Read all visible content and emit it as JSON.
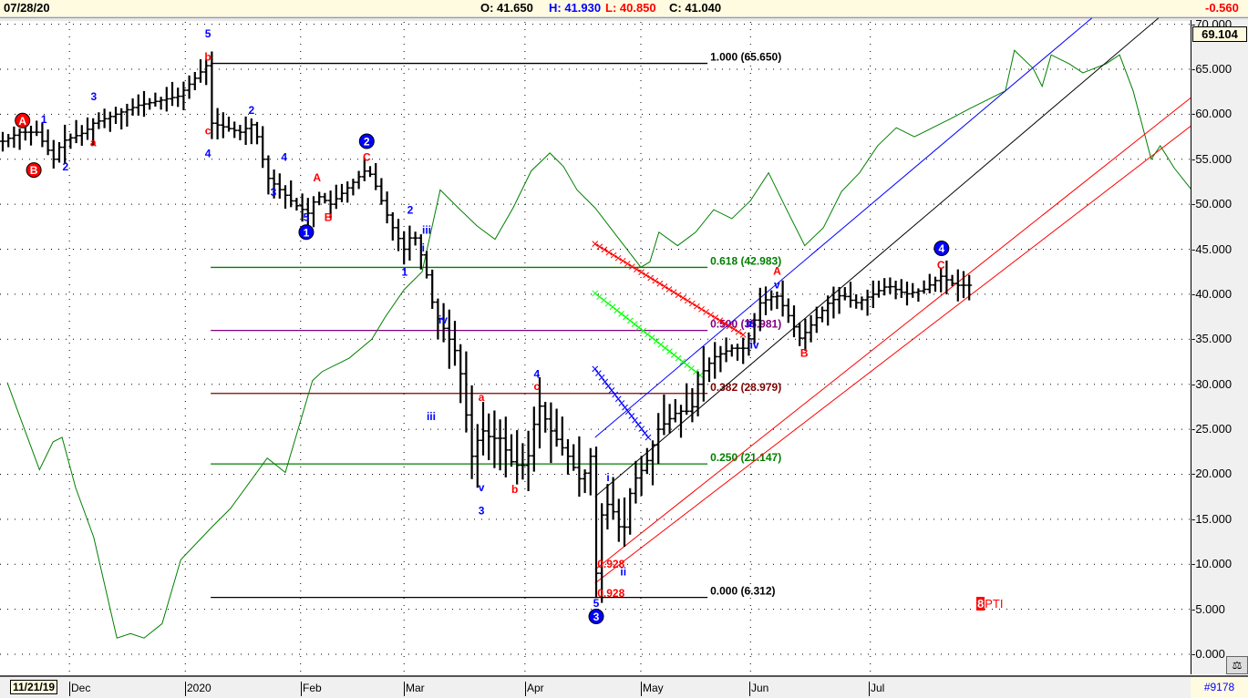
{
  "header": {
    "date": "07/28/20",
    "open": "O: 41.650",
    "high": "H: 41.930",
    "low": "L: 40.850",
    "close": "C: 41.040",
    "change": "-0.560"
  },
  "axis": {
    "last_value": "69.104",
    "count": "#9178",
    "start_date": "11/21/19",
    "months": [
      "Dec",
      "2020",
      "Feb",
      "Mar",
      "Apr",
      "May",
      "Jun",
      "Jul"
    ]
  },
  "indicator_label": {
    "number": "8",
    "name": "PTI"
  },
  "colors": {
    "bars": "#000000",
    "oscillator": "#008000",
    "up": "#0000ff",
    "down": "#ff0000"
  },
  "chart_data": {
    "type": "ohlc",
    "ylim": [
      -2,
      72
    ],
    "y_ticks": [
      "0.000",
      "5.000",
      "10.000",
      "15.000",
      "20.000",
      "25.000",
      "30.000",
      "35.000",
      "40.000",
      "45.000",
      "50.000",
      "55.000",
      "60.000",
      "65.000",
      "70.000"
    ],
    "y_tick_values": [
      0,
      5,
      10,
      15,
      20,
      25,
      30,
      35,
      40,
      45,
      50,
      55,
      60,
      65,
      70
    ],
    "month_days": [
      11.8,
      32.3,
      52.7,
      71,
      92.4,
      112.9,
      132.3,
      153.5
    ],
    "price_path": [
      [
        0,
        57
      ],
      [
        3,
        58
      ],
      [
        6,
        58
      ],
      [
        9,
        55
      ],
      [
        10.5,
        57
      ],
      [
        14.5,
        58
      ],
      [
        16,
        59
      ],
      [
        24,
        61
      ],
      [
        31,
        62
      ],
      [
        34,
        64
      ],
      [
        36.3,
        65.6
      ],
      [
        37,
        59
      ],
      [
        42,
        58
      ],
      [
        44.4,
        59
      ],
      [
        46.8,
        53
      ],
      [
        48.4,
        52
      ],
      [
        51.6,
        50
      ],
      [
        54,
        49
      ],
      [
        55.6,
        51
      ],
      [
        58,
        50
      ],
      [
        61.3,
        52
      ],
      [
        64.5,
        54
      ],
      [
        66,
        52
      ],
      [
        68.5,
        48
      ],
      [
        71,
        45
      ],
      [
        72.6,
        47
      ],
      [
        74.2,
        44
      ],
      [
        75.5,
        41
      ],
      [
        76.3,
        38
      ],
      [
        78.2,
        36
      ],
      [
        80.6,
        33
      ],
      [
        83,
        22
      ],
      [
        84.7,
        25
      ],
      [
        86.3,
        24
      ],
      [
        88,
        24
      ],
      [
        90.3,
        21
      ],
      [
        92.7,
        21
      ],
      [
        94.7,
        28
      ],
      [
        96.8,
        25
      ],
      [
        100,
        22
      ],
      [
        102.4,
        19
      ],
      [
        104,
        22
      ],
      [
        104.8,
        7
      ],
      [
        105.6,
        15
      ],
      [
        107.3,
        17
      ],
      [
        109.7,
        13
      ],
      [
        111.3,
        19
      ],
      [
        113.7,
        21
      ],
      [
        116,
        25
      ],
      [
        119.4,
        27
      ],
      [
        121.8,
        27
      ],
      [
        123.4,
        31
      ],
      [
        125.8,
        33
      ],
      [
        129,
        34
      ],
      [
        131.5,
        34
      ],
      [
        133.9,
        39
      ],
      [
        136.8,
        40
      ],
      [
        138.7,
        38
      ],
      [
        141.1,
        35
      ],
      [
        143.5,
        37
      ],
      [
        146,
        39
      ],
      [
        148.4,
        40
      ],
      [
        150.8,
        39
      ],
      [
        154,
        40
      ],
      [
        156.5,
        41
      ],
      [
        159.7,
        40
      ],
      [
        162.9,
        40.5
      ],
      [
        166,
        42
      ],
      [
        168.5,
        41
      ],
      [
        171,
        41
      ]
    ],
    "oscillator": [
      [
        0.8,
        30.2
      ],
      [
        3.2,
        26.1
      ],
      [
        6.5,
        20.5
      ],
      [
        8.9,
        23.6
      ],
      [
        10.5,
        24.1
      ],
      [
        12.9,
        18.5
      ],
      [
        16.1,
        13
      ],
      [
        20.2,
        1.8
      ],
      [
        22.6,
        2.3
      ],
      [
        25,
        1.8
      ],
      [
        28.2,
        3.4
      ],
      [
        31.5,
        10.5
      ],
      [
        37.1,
        14.2
      ],
      [
        40.3,
        16.2
      ],
      [
        46.8,
        21.8
      ],
      [
        50,
        20.2
      ],
      [
        54.8,
        30.4
      ],
      [
        56.5,
        31.4
      ],
      [
        61.3,
        32.9
      ],
      [
        65.3,
        35
      ],
      [
        67.7,
        37.5
      ],
      [
        71,
        40.5
      ],
      [
        74.2,
        42.5
      ],
      [
        77.4,
        51.6
      ],
      [
        80.6,
        49.6
      ],
      [
        83.9,
        47.6
      ],
      [
        87.1,
        46.1
      ],
      [
        90.3,
        49.6
      ],
      [
        93.5,
        53.7
      ],
      [
        96.8,
        55.7
      ],
      [
        99.2,
        54.2
      ],
      [
        101.6,
        51.6
      ],
      [
        104.8,
        49.6
      ],
      [
        109.7,
        45.6
      ],
      [
        112.9,
        43
      ],
      [
        114.5,
        43.6
      ],
      [
        116.1,
        46.9
      ],
      [
        119.4,
        45.4
      ],
      [
        122.6,
        46.9
      ],
      [
        125.8,
        49.4
      ],
      [
        129,
        48.4
      ],
      [
        132.3,
        50.4
      ],
      [
        135.5,
        53.5
      ],
      [
        138.7,
        49.4
      ],
      [
        141.9,
        45.4
      ],
      [
        145.2,
        47.4
      ],
      [
        148.4,
        51.4
      ],
      [
        151.6,
        53.5
      ],
      [
        154.8,
        56.5
      ],
      [
        158.1,
        58.5
      ],
      [
        161.3,
        57.5
      ],
      [
        164.5,
        58.5
      ],
      [
        167.7,
        59.5
      ],
      [
        171,
        60.6
      ],
      [
        174.2,
        61.6
      ],
      [
        177.4,
        62.6
      ],
      [
        179,
        67.1
      ],
      [
        182.3,
        65.1
      ],
      [
        183.9,
        63.1
      ],
      [
        185.5,
        66.6
      ],
      [
        188.7,
        65.6
      ],
      [
        191.1,
        64.6
      ],
      [
        195.2,
        65.6
      ],
      [
        197.6,
        66.6
      ],
      [
        200,
        62.6
      ],
      [
        203.2,
        55
      ],
      [
        204.8,
        56.5
      ],
      [
        207.3,
        54
      ],
      [
        210.6,
        51.4
      ]
    ],
    "fib_levels": [
      {
        "label": "1.000 (65.650)",
        "value": 65.65,
        "color": "#000000"
      },
      {
        "label": "0.618 (42.983)",
        "value": 42.983,
        "color": "#008000"
      },
      {
        "label": "0.500 (35.981)",
        "value": 35.981,
        "color": "#800080"
      },
      {
        "label": "0.382 (28.979)",
        "value": 28.979,
        "color": "#800000"
      },
      {
        "label": "0.250 (21.147)",
        "value": 21.147,
        "color": "#008000"
      },
      {
        "label": "0.000 (6.312)",
        "value": 6.312,
        "color": "#000000"
      }
    ],
    "fib_range_days": [
      36.8,
      124.7
    ],
    "channels": [
      {
        "from": [
          104.8,
          24.1
        ],
        "to": [
          192.7,
          70.7
        ],
        "color": "#0000ff"
      },
      {
        "from": [
          104.8,
          17.5
        ],
        "to": [
          204.5,
          70.7
        ],
        "color": "#000000"
      },
      {
        "from": [
          104.8,
          9.4
        ],
        "to": [
          220.8,
          67.1
        ],
        "color": "#ff0000"
      },
      {
        "from": [
          104.8,
          7.9
        ],
        "to": [
          220.8,
          63.8
        ],
        "color": "#ff0000"
      }
    ],
    "speed_lines": [
      {
        "from": [
          104.8,
          45.6
        ],
        "to": [
          131,
          35.5
        ],
        "color": "#ff0000"
      },
      {
        "from": [
          104.8,
          40.1
        ],
        "to": [
          123.4,
          31
        ],
        "color": "#00ff00"
      },
      {
        "from": [
          104.8,
          31.7
        ],
        "to": [
          114.2,
          24.1
        ],
        "color": "#0000ff"
      }
    ],
    "ratio_labels": [
      {
        "text": "0.928",
        "day": 105.2,
        "price": 10
      },
      {
        "text": "0.928",
        "day": 105.2,
        "price": 6.8
      }
    ],
    "wave_labels": [
      {
        "t": "5",
        "d": 36.3,
        "p": 69,
        "c": "b"
      },
      {
        "t": "b",
        "d": 36.3,
        "p": 66.4,
        "c": "r"
      },
      {
        "t": "3",
        "d": 16.1,
        "p": 62,
        "c": "b"
      },
      {
        "t": "1",
        "d": 7.3,
        "p": 59.5,
        "c": "b"
      },
      {
        "t": "A",
        "d": 3.5,
        "p": 59.3,
        "c": "r",
        "o": 1
      },
      {
        "t": "B",
        "d": 5.5,
        "p": 53.8,
        "c": "r",
        "o": 1
      },
      {
        "t": "2",
        "d": 11.1,
        "p": 54.2,
        "c": "b"
      },
      {
        "t": "a",
        "d": 16,
        "p": 56.9,
        "c": "r"
      },
      {
        "t": "c",
        "d": 36.3,
        "p": 58.2,
        "c": "r"
      },
      {
        "t": "4",
        "d": 36.3,
        "p": 55.7,
        "c": "b"
      },
      {
        "t": "2",
        "d": 44,
        "p": 60.5,
        "c": "b"
      },
      {
        "t": "4",
        "d": 49.8,
        "p": 55.3,
        "c": "b"
      },
      {
        "t": "3",
        "d": 47.9,
        "p": 51.4,
        "c": "b"
      },
      {
        "t": "A",
        "d": 55.6,
        "p": 53,
        "c": "r"
      },
      {
        "t": "B",
        "d": 57.6,
        "p": 48.6,
        "c": "r"
      },
      {
        "t": "5",
        "d": 53.7,
        "p": 48.6,
        "c": "b"
      },
      {
        "t": "1",
        "d": 53.7,
        "p": 46.9,
        "c": "b",
        "o": 1
      },
      {
        "t": "C",
        "d": 64.4,
        "p": 55.3,
        "c": "r"
      },
      {
        "t": "2",
        "d": 64.4,
        "p": 57,
        "c": "b",
        "o": 1
      },
      {
        "t": "2",
        "d": 72.1,
        "p": 49.4,
        "c": "b"
      },
      {
        "t": "iii",
        "d": 75,
        "p": 47.2,
        "c": "b"
      },
      {
        "t": "i",
        "d": 74.4,
        "p": 45.2,
        "c": "b"
      },
      {
        "t": "1",
        "d": 71.1,
        "p": 42.5,
        "c": "b"
      },
      {
        "t": "iv",
        "d": 77.9,
        "p": 37.2,
        "c": "b"
      },
      {
        "t": "iii",
        "d": 75.8,
        "p": 26.5,
        "c": "b"
      },
      {
        "t": "a",
        "d": 84.7,
        "p": 28.6,
        "c": "r"
      },
      {
        "t": "v",
        "d": 84.7,
        "p": 18.6,
        "c": "b"
      },
      {
        "t": "3",
        "d": 84.7,
        "p": 16,
        "c": "b"
      },
      {
        "t": "b",
        "d": 90.6,
        "p": 18.4,
        "c": "r"
      },
      {
        "t": "4",
        "d": 94.5,
        "p": 31.2,
        "c": "b"
      },
      {
        "t": "c",
        "d": 94.5,
        "p": 29.8,
        "c": "r"
      },
      {
        "t": "5",
        "d": 105,
        "p": 5.7,
        "c": "b"
      },
      {
        "t": "3",
        "d": 105,
        "p": 4.2,
        "c": "b",
        "o": 1
      },
      {
        "t": "i",
        "d": 107.1,
        "p": 19.7,
        "c": "b"
      },
      {
        "t": "ii",
        "d": 109.8,
        "p": 9.2,
        "c": "b"
      },
      {
        "t": "iii",
        "d": 132.3,
        "p": 36.8,
        "c": "b"
      },
      {
        "t": "iv",
        "d": 133,
        "p": 34.4,
        "c": "b"
      },
      {
        "t": "v",
        "d": 137,
        "p": 41.1,
        "c": "b"
      },
      {
        "t": "A",
        "d": 137,
        "p": 42.6,
        "c": "r"
      },
      {
        "t": "B",
        "d": 141.8,
        "p": 33.5,
        "c": "r"
      },
      {
        "t": "C",
        "d": 166,
        "p": 43.3,
        "c": "r"
      },
      {
        "t": "4",
        "d": 166.1,
        "p": 45.1,
        "c": "b",
        "o": 1
      }
    ]
  }
}
